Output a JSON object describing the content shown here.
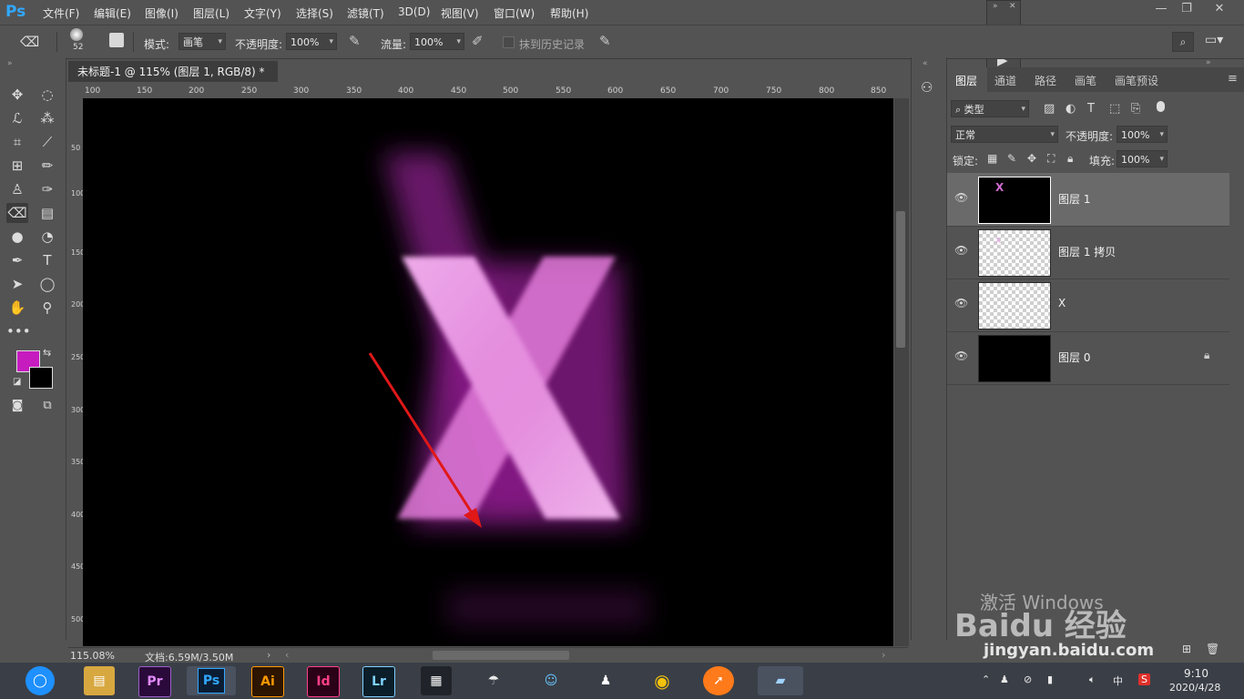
{
  "app": {
    "logo": "Ps"
  },
  "menu": [
    "文件(F)",
    "编辑(E)",
    "图像(I)",
    "图层(L)",
    "文字(Y)",
    "选择(S)",
    "滤镜(T)",
    "3D(D)",
    "视图(V)",
    "窗口(W)",
    "帮助(H)"
  ],
  "window_controls": {
    "minimize": "—",
    "restore": "❐",
    "close": "✕"
  },
  "options": {
    "brush_size": "52",
    "mode_label": "模式:",
    "mode_value": "画笔",
    "opacity_label": "不透明度:",
    "opacity_value": "100%",
    "flow_label": "流量:",
    "flow_value": "100%",
    "erase_history_label": "抹到历史记录"
  },
  "document": {
    "tab_title": "未标题-1 @ 115% (图层 1, RGB/8) *",
    "close": "×"
  },
  "ruler": {
    "h_ticks": [
      "100",
      "150",
      "200",
      "250",
      "300",
      "350",
      "400",
      "450",
      "500",
      "550",
      "600",
      "650",
      "700",
      "750",
      "800",
      "850"
    ],
    "v_ticks": [
      "50",
      "100",
      "150",
      "200",
      "250",
      "300",
      "350",
      "400",
      "450",
      "500"
    ]
  },
  "status": {
    "zoom": "115.08%",
    "doc_size": "文档:6.59M/3.50M"
  },
  "canvas": {
    "letter": "X",
    "letter_color": "#e07ad8",
    "glow_color": "#b020b0",
    "arrow_color": "#e01818"
  },
  "colors": {
    "foreground": "#c61bbf",
    "background": "#000000"
  },
  "layers_panel": {
    "tabs": [
      "图层",
      "通道",
      "路径",
      "画笔",
      "画笔预设"
    ],
    "filter_label": "类型",
    "blend_mode": "正常",
    "opacity_label": "不透明度:",
    "opacity_value": "100%",
    "lock_label": "锁定:",
    "fill_label": "填充:",
    "fill_value": "100%",
    "layers": [
      {
        "name": "图层 1",
        "thumb": "black",
        "selected": true
      },
      {
        "name": "图层 1 拷贝",
        "thumb": "checker",
        "selected": false
      },
      {
        "name": "X",
        "thumb": "checker",
        "selected": false
      },
      {
        "name": "图层 0",
        "thumb": "black",
        "selected": false,
        "locked": true
      }
    ]
  },
  "watermark": {
    "activate": "激活 Windows",
    "brand": "Baidu 经验",
    "url": "jingyan.baidu.com"
  },
  "taskbar": {
    "apps": [
      "Pr",
      "Ps",
      "Ai",
      "Id",
      "Lr"
    ],
    "ime": "中",
    "time": "9:10",
    "date": "2020/4/28"
  }
}
